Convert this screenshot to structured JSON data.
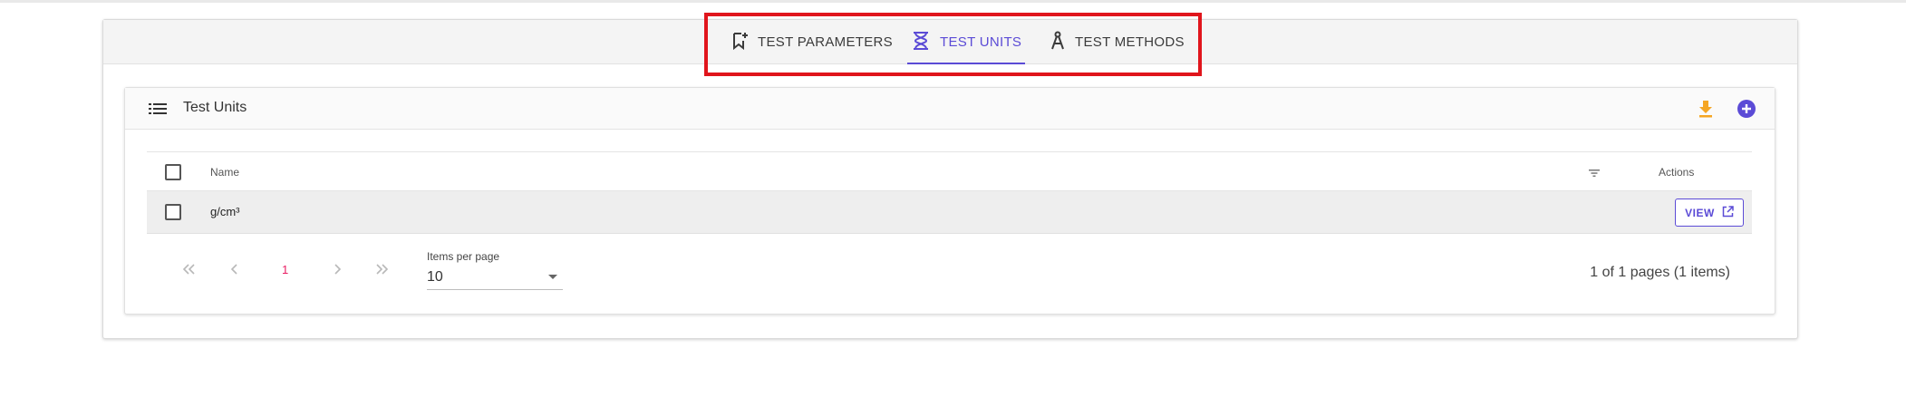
{
  "tabs": [
    {
      "label": "TEST PARAMETERS",
      "icon": "bookmark-add-icon",
      "active": false
    },
    {
      "label": "TEST UNITS",
      "icon": "hourglass-icon",
      "active": true
    },
    {
      "label": "TEST METHODS",
      "icon": "compass-icon",
      "active": false
    }
  ],
  "card": {
    "title": "Test Units"
  },
  "table": {
    "columns": {
      "name": "Name",
      "actions": "Actions"
    },
    "rows": [
      {
        "name": "g/cm³",
        "action_label": "VIEW"
      }
    ]
  },
  "paginator": {
    "current_page": "1",
    "items_per_page_label": "Items per page",
    "items_per_page_value": "10",
    "range_label": "1 of 1 pages (1 items)"
  },
  "colors": {
    "accent": "#5b4bd6",
    "download": "#f5a623",
    "highlight": "#e0151c",
    "page_number": "#e91e63"
  }
}
